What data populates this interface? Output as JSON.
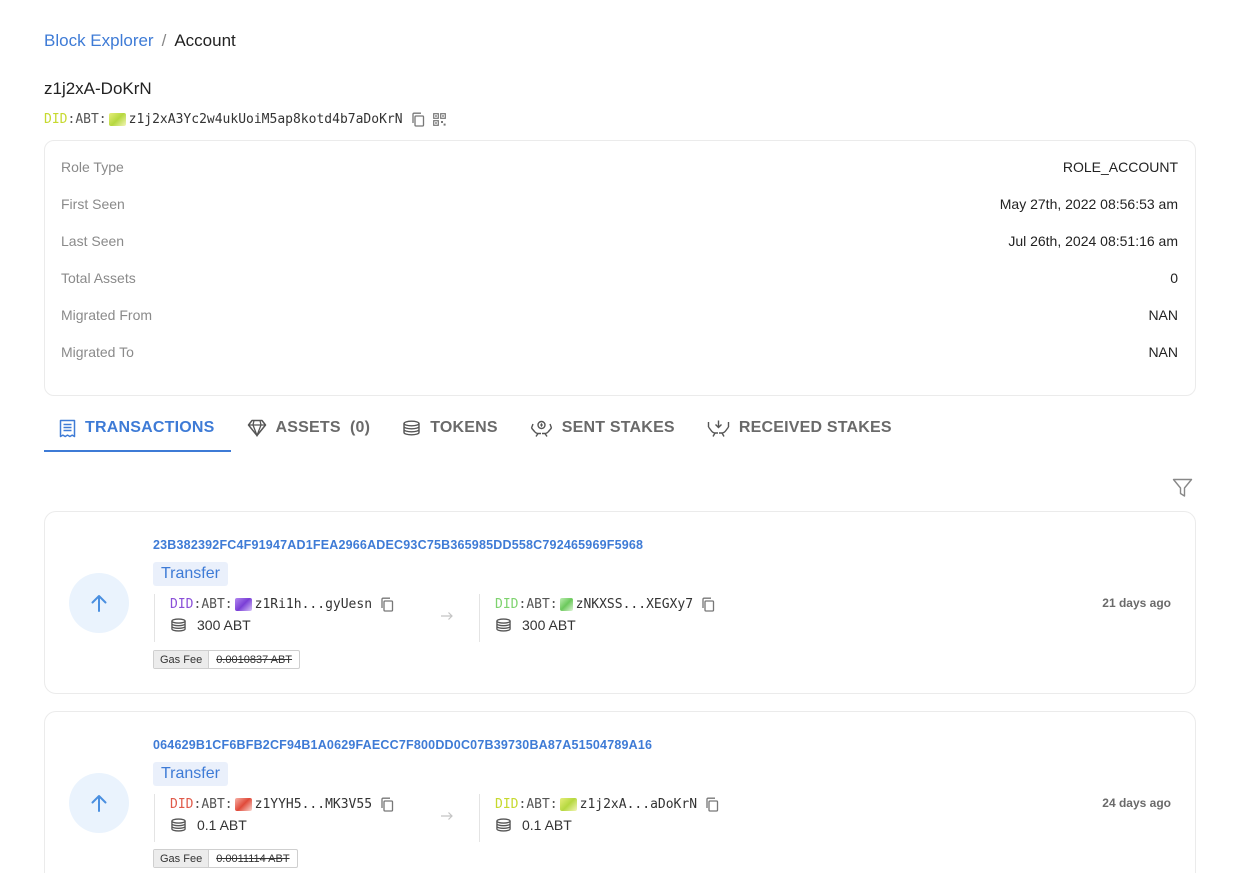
{
  "breadcrumb": {
    "root": "Block Explorer",
    "separator": "/",
    "current": "Account"
  },
  "account": {
    "name": "z1j2xA-DoKrN",
    "did_prefix": "DID",
    "did_colon1": ":",
    "did_chain": "ABT",
    "did_colon2": ":",
    "address": "z1j2xA3Yc2w4ukUoiM5ap8kotd4b7aDoKrN"
  },
  "info": [
    {
      "label": "Role Type",
      "value": "ROLE_ACCOUNT"
    },
    {
      "label": "First Seen",
      "value": "May 27th, 2022 08:56:53 am"
    },
    {
      "label": "Last Seen",
      "value": "Jul 26th, 2024 08:51:16 am"
    },
    {
      "label": "Total Assets",
      "value": "0"
    },
    {
      "label": "Migrated From",
      "value": "NAN"
    },
    {
      "label": "Migrated To",
      "value": "NAN"
    }
  ],
  "tabs": [
    {
      "label": "TRANSACTIONS",
      "icon": "receipt-icon",
      "active": true
    },
    {
      "label": "ASSETS  (0)",
      "icon": "diamond-icon",
      "active": false
    },
    {
      "label": "TOKENS",
      "icon": "coins-icon",
      "active": false
    },
    {
      "label": "SENT STAKES",
      "icon": "stake-out-icon",
      "active": false
    },
    {
      "label": "RECEIVED STAKES",
      "icon": "stake-in-icon",
      "active": false
    }
  ],
  "transactions": [
    {
      "hash": "23B382392FC4F91947AD1FEA2966ADEC93C75B365985DD558C792465969F5968",
      "type": "Transfer",
      "from": {
        "prefix": "DID",
        "chain": "ABT",
        "address": "z1Ri1h...gyUesn",
        "amount": "300 ABT",
        "prefix_color": "#8a4fd8"
      },
      "to": {
        "prefix": "DID",
        "chain": "ABT",
        "address": "zNKXSS...XEGXy7",
        "amount": "300 ABT",
        "prefix_color": "#7ed36e"
      },
      "time": "21 days ago",
      "gas_label": "Gas Fee",
      "gas_value": "0.0010837 ABT"
    },
    {
      "hash": "064629B1CF6BFB2CF94B1A0629FAECC7F800DD0C07B39730BA87A51504789A16",
      "type": "Transfer",
      "from": {
        "prefix": "DID",
        "chain": "ABT",
        "address": "z1YYH5...MK3V55",
        "amount": "0.1 ABT",
        "prefix_color": "#e05a4a"
      },
      "to": {
        "prefix": "DID",
        "chain": "ABT",
        "address": "z1j2xA...aDoKrN",
        "amount": "0.1 ABT",
        "prefix_color": "#c6d92e"
      },
      "time": "24 days ago",
      "gas_label": "Gas Fee",
      "gas_value": "0.0011114 ABT"
    }
  ],
  "colors": {
    "accent": "#3e7bd6",
    "border": "#ebebeb",
    "muted": "#8a8a8a",
    "did_yellow": "#c6d92e"
  }
}
